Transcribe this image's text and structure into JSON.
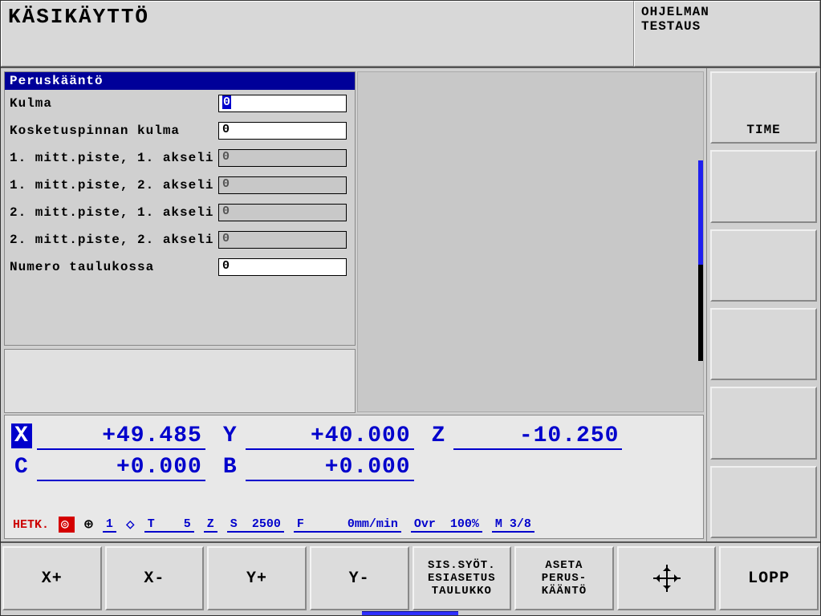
{
  "header": {
    "title": "KÄSIKÄYTTÖ",
    "mode_line1": "OHJELMAN",
    "mode_line2": "TESTAUS"
  },
  "form": {
    "title": "Peruskääntö",
    "rows": [
      {
        "label": "Kulma",
        "value": "0",
        "editable": true,
        "active": true
      },
      {
        "label": "Kosketuspinnan kulma",
        "value": "0",
        "editable": true,
        "active": false
      },
      {
        "label": "1. mitt.piste, 1. akseli",
        "value": "0",
        "editable": false,
        "active": false
      },
      {
        "label": "1. mitt.piste, 2. akseli",
        "value": "0",
        "editable": false,
        "active": false
      },
      {
        "label": "2. mitt.piste, 1. akseli",
        "value": "0",
        "editable": false,
        "active": false
      },
      {
        "label": "2. mitt.piste, 2. akseli",
        "value": "0",
        "editable": false,
        "active": false
      },
      {
        "label": "Numero taulukossa",
        "value": "0",
        "editable": true,
        "active": false
      }
    ]
  },
  "dro": {
    "axes": [
      {
        "axis": "X",
        "value": "+49.485",
        "highlight": true
      },
      {
        "axis": "Y",
        "value": "+40.000",
        "highlight": false
      },
      {
        "axis": "Z",
        "value": "-10.250",
        "highlight": false
      },
      {
        "axis": "C",
        "value": "+0.000",
        "highlight": false
      },
      {
        "axis": "B",
        "value": "+0.000",
        "highlight": false
      }
    ]
  },
  "status": {
    "hetk": "HETK.",
    "datum_no": "1",
    "t_label": "T",
    "t_value": "5",
    "z_label": "Z",
    "s_label": "S",
    "s_value": "2500",
    "f_label": "F",
    "f_value": "0mm/min",
    "ovr_label": "Ovr",
    "ovr_value": "100%",
    "m_label": "M 3/8"
  },
  "right_softkeys": [
    "TIME",
    "",
    "",
    "",
    "",
    ""
  ],
  "bottom_softkeys": {
    "k1": "X+",
    "k2": "X-",
    "k3": "Y+",
    "k4": "Y-",
    "k5_l1": "SIS.SYÖT.",
    "k5_l2": "ESIASETUS",
    "k5_l3": "TAULUKKO",
    "k6_l1": "ASETA",
    "k6_l2": "PERUS-",
    "k6_l3": "KÄÄNTÖ",
    "k8": "LOPP"
  },
  "icons": {
    "datum": "datum-icon",
    "target": "target-icon",
    "probe": "probe-icon",
    "crosshair": "crosshair-icon"
  }
}
